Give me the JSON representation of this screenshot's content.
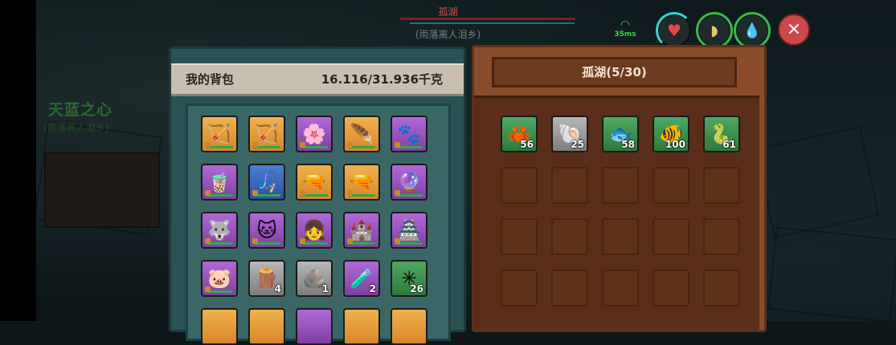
{
  "hud": {
    "target_name": "孤湖",
    "target_subtitle": "(雨落离人泪乡)",
    "ghost_title": "天蓝之心",
    "ghost_subtitle": "(雨落离人泪乡)",
    "ping": "35ms"
  },
  "status_icons": [
    {
      "icon": "heart-icon",
      "color": "#e24848"
    },
    {
      "icon": "stomach-icon",
      "color": "#e9c860"
    },
    {
      "icon": "water-drop-icon",
      "color": "#3fc2c9"
    }
  ],
  "backpack": {
    "title": "我的背包",
    "weight": "16.116/31.936千克",
    "items": [
      {
        "name": "crossbow",
        "rarity": "orange",
        "glyph": "🏹",
        "count": ""
      },
      {
        "name": "bow",
        "rarity": "orange",
        "glyph": "🏹",
        "count": ""
      },
      {
        "name": "blossom-staff",
        "rarity": "purple",
        "glyph": "🌸",
        "count": ""
      },
      {
        "name": "feather",
        "rarity": "orange",
        "glyph": "🪶",
        "count": ""
      },
      {
        "name": "paw-staff",
        "rarity": "purple",
        "glyph": "🐾",
        "count": ""
      },
      {
        "name": "bubble-tea",
        "rarity": "purple",
        "glyph": "🧋",
        "count": ""
      },
      {
        "name": "fishing-rod",
        "rarity": "blue",
        "glyph": "🎣",
        "count": ""
      },
      {
        "name": "flame-gun",
        "rarity": "orange",
        "glyph": "🔫",
        "count": ""
      },
      {
        "name": "lightning-gun",
        "rarity": "orange",
        "glyph": "🔫",
        "count": ""
      },
      {
        "name": "purple-cluster",
        "rarity": "purple",
        "glyph": "🔮",
        "count": ""
      },
      {
        "name": "wolf-mask",
        "rarity": "purple",
        "glyph": "🐺",
        "count": ""
      },
      {
        "name": "cat-helmet",
        "rarity": "purple",
        "glyph": "🐱",
        "count": ""
      },
      {
        "name": "girl-head",
        "rarity": "purple",
        "glyph": "👧",
        "count": ""
      },
      {
        "name": "castle-hat",
        "rarity": "purple",
        "glyph": "🏰",
        "count": ""
      },
      {
        "name": "red-castle",
        "rarity": "purple",
        "glyph": "🏯",
        "count": ""
      },
      {
        "name": "pig-face",
        "rarity": "purple",
        "glyph": "🐷",
        "count": ""
      },
      {
        "name": "log",
        "rarity": "gray",
        "glyph": "🪵",
        "count": "4"
      },
      {
        "name": "stone-pile",
        "rarity": "gray",
        "glyph": "🪨",
        "count": "1"
      },
      {
        "name": "blue-potion",
        "rarity": "purple",
        "glyph": "🧪",
        "count": "2"
      },
      {
        "name": "green-gem",
        "rarity": "green",
        "glyph": "✳",
        "count": "26"
      }
    ]
  },
  "lake": {
    "title": "孤湖(5/30)",
    "items": [
      {
        "name": "red-crab",
        "rarity": "green",
        "glyph": "🦀",
        "count": "56"
      },
      {
        "name": "fan-shell",
        "rarity": "gray",
        "glyph": "🐚",
        "count": "25"
      },
      {
        "name": "yellow-fish",
        "rarity": "green",
        "glyph": "🐟",
        "count": "58"
      },
      {
        "name": "pink-fish",
        "rarity": "green",
        "glyph": "🐠",
        "count": "100"
      },
      {
        "name": "eel",
        "rarity": "green",
        "glyph": "🐍",
        "count": "61"
      }
    ]
  }
}
